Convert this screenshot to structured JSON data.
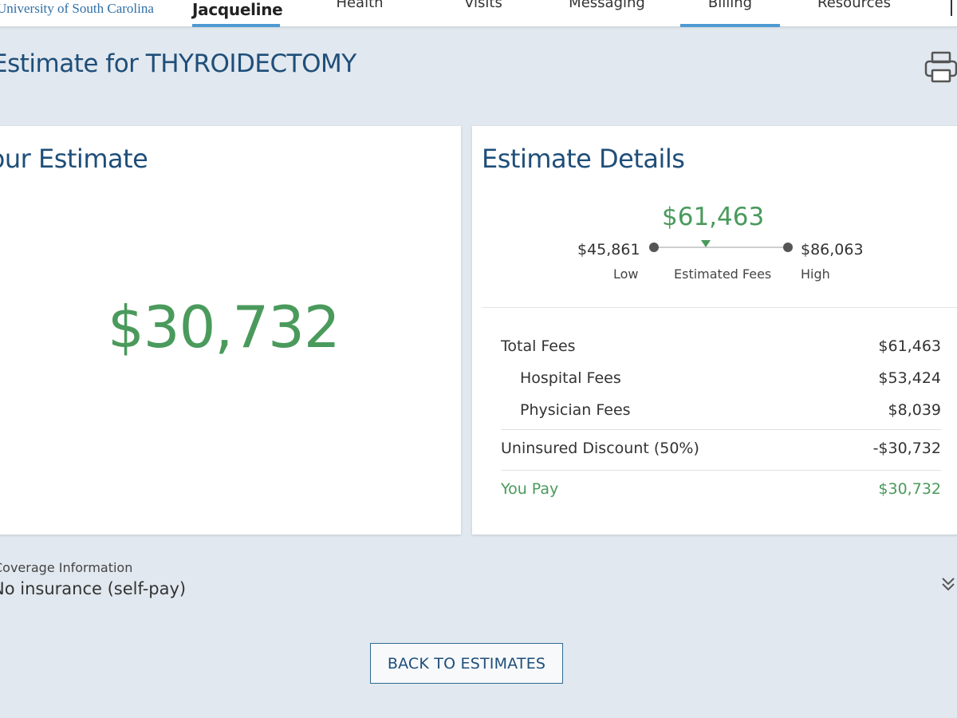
{
  "nav": {
    "org_name": "University of South Carolina",
    "user_name": "Jacqueline",
    "tabs": [
      {
        "label": "Health"
      },
      {
        "label": "Visits"
      },
      {
        "label": "Messaging"
      },
      {
        "label": "Billing"
      },
      {
        "label": "Resources"
      }
    ],
    "active_tab": "Billing"
  },
  "page": {
    "title": "Estimate for THYROIDECTOMY"
  },
  "estimate_card": {
    "title": "Your Estimate",
    "amount": "$30,732"
  },
  "details_card": {
    "title": "Estimate Details",
    "range": {
      "estimated": "$61,463",
      "low_value": "$45,861",
      "low_label": "Low",
      "estimated_label": "Estimated Fees",
      "high_value": "$86,063",
      "high_label": "High"
    },
    "rows": [
      {
        "label": "Total Fees",
        "value": "$61,463"
      },
      {
        "label": "Hospital Fees",
        "value": "$53,424"
      },
      {
        "label": "Physician Fees",
        "value": "$8,039"
      },
      {
        "label": "Uninsured Discount (50%)",
        "value": "-$30,732"
      },
      {
        "label": "You Pay",
        "value": "$30,732"
      }
    ]
  },
  "coverage": {
    "label": "Coverage Information",
    "value": "No insurance (self-pay)"
  },
  "actions": {
    "back_label": "BACK TO ESTIMATES"
  },
  "colors": {
    "accent_blue": "#1f4e79",
    "tab_underline": "#4d9ad3",
    "money_green": "#4a9a5c",
    "background": "#e1e8ef"
  }
}
